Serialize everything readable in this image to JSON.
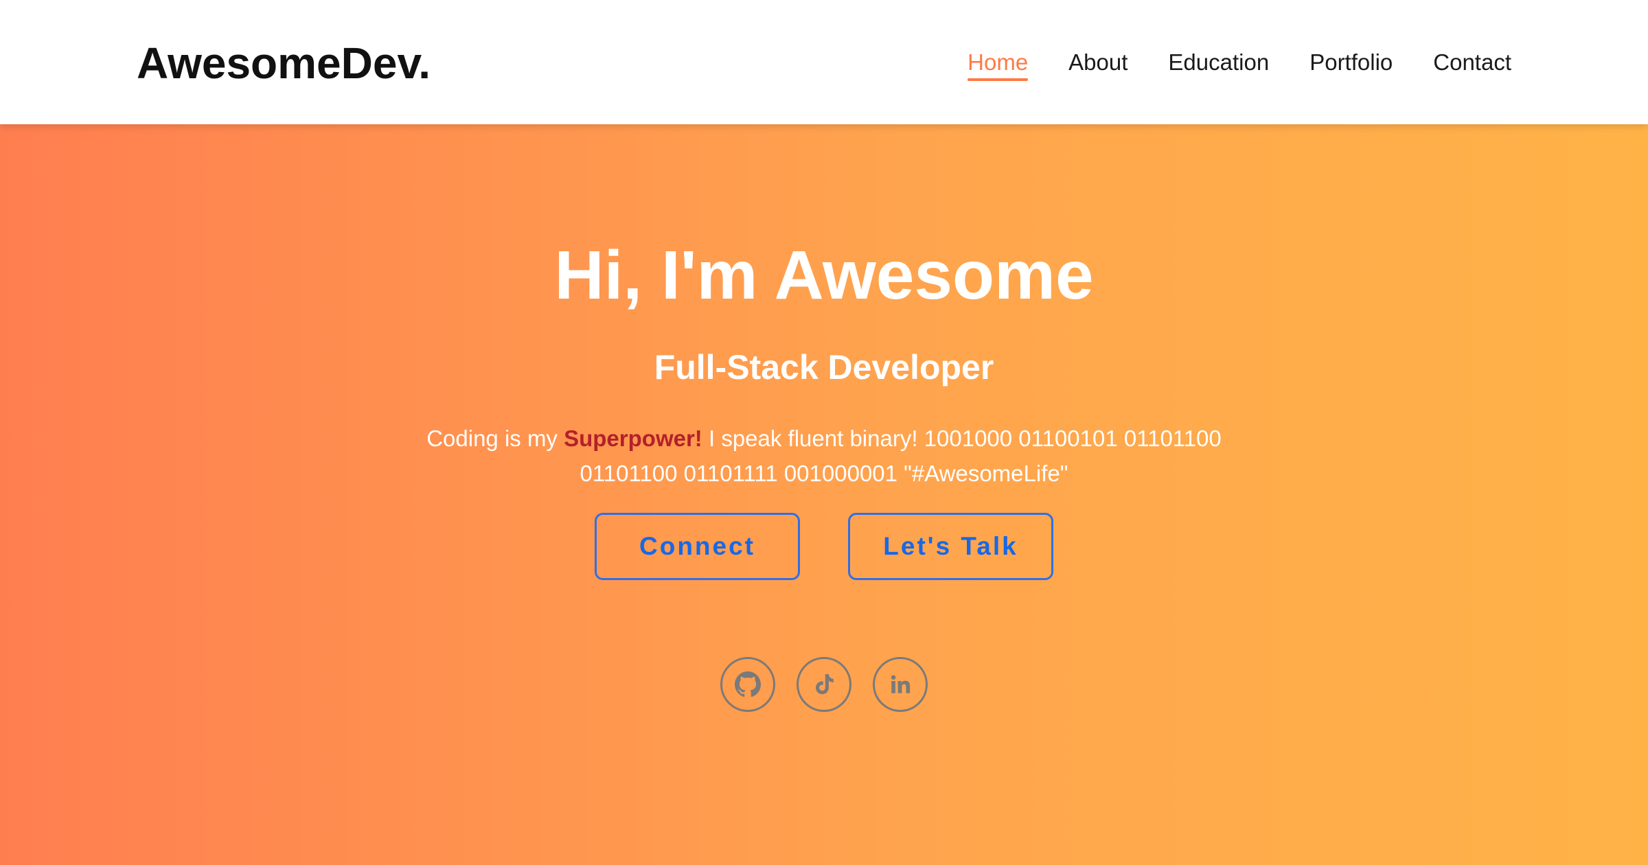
{
  "navbar": {
    "logo": "AwesomeDev.",
    "links": [
      {
        "label": "Home",
        "active": true
      },
      {
        "label": "About",
        "active": false
      },
      {
        "label": "Education",
        "active": false
      },
      {
        "label": "Portfolio",
        "active": false
      },
      {
        "label": "Contact",
        "active": false
      }
    ]
  },
  "hero": {
    "title": "Hi, I'm Awesome",
    "subtitle": "Full-Stack Developer",
    "text_before": "Coding is my ",
    "highlight": "Superpower!",
    "text_after": " I speak fluent binary! 1001000 01100101 01101100 01101100 01101111 001000001 \"#AwesomeLife\"",
    "buttons": {
      "connect": "Connect",
      "talk": "Let's Talk"
    },
    "social_icons": [
      "github-icon",
      "tiktok-icon",
      "linkedin-icon"
    ]
  },
  "colors": {
    "accent": "#ff7a45",
    "gradient_start": "#ff7e50",
    "gradient_end": "#ffb347",
    "button_blue": "#1768e6",
    "highlight_red": "#b3202a",
    "icon_gray": "#7a7a7a"
  }
}
